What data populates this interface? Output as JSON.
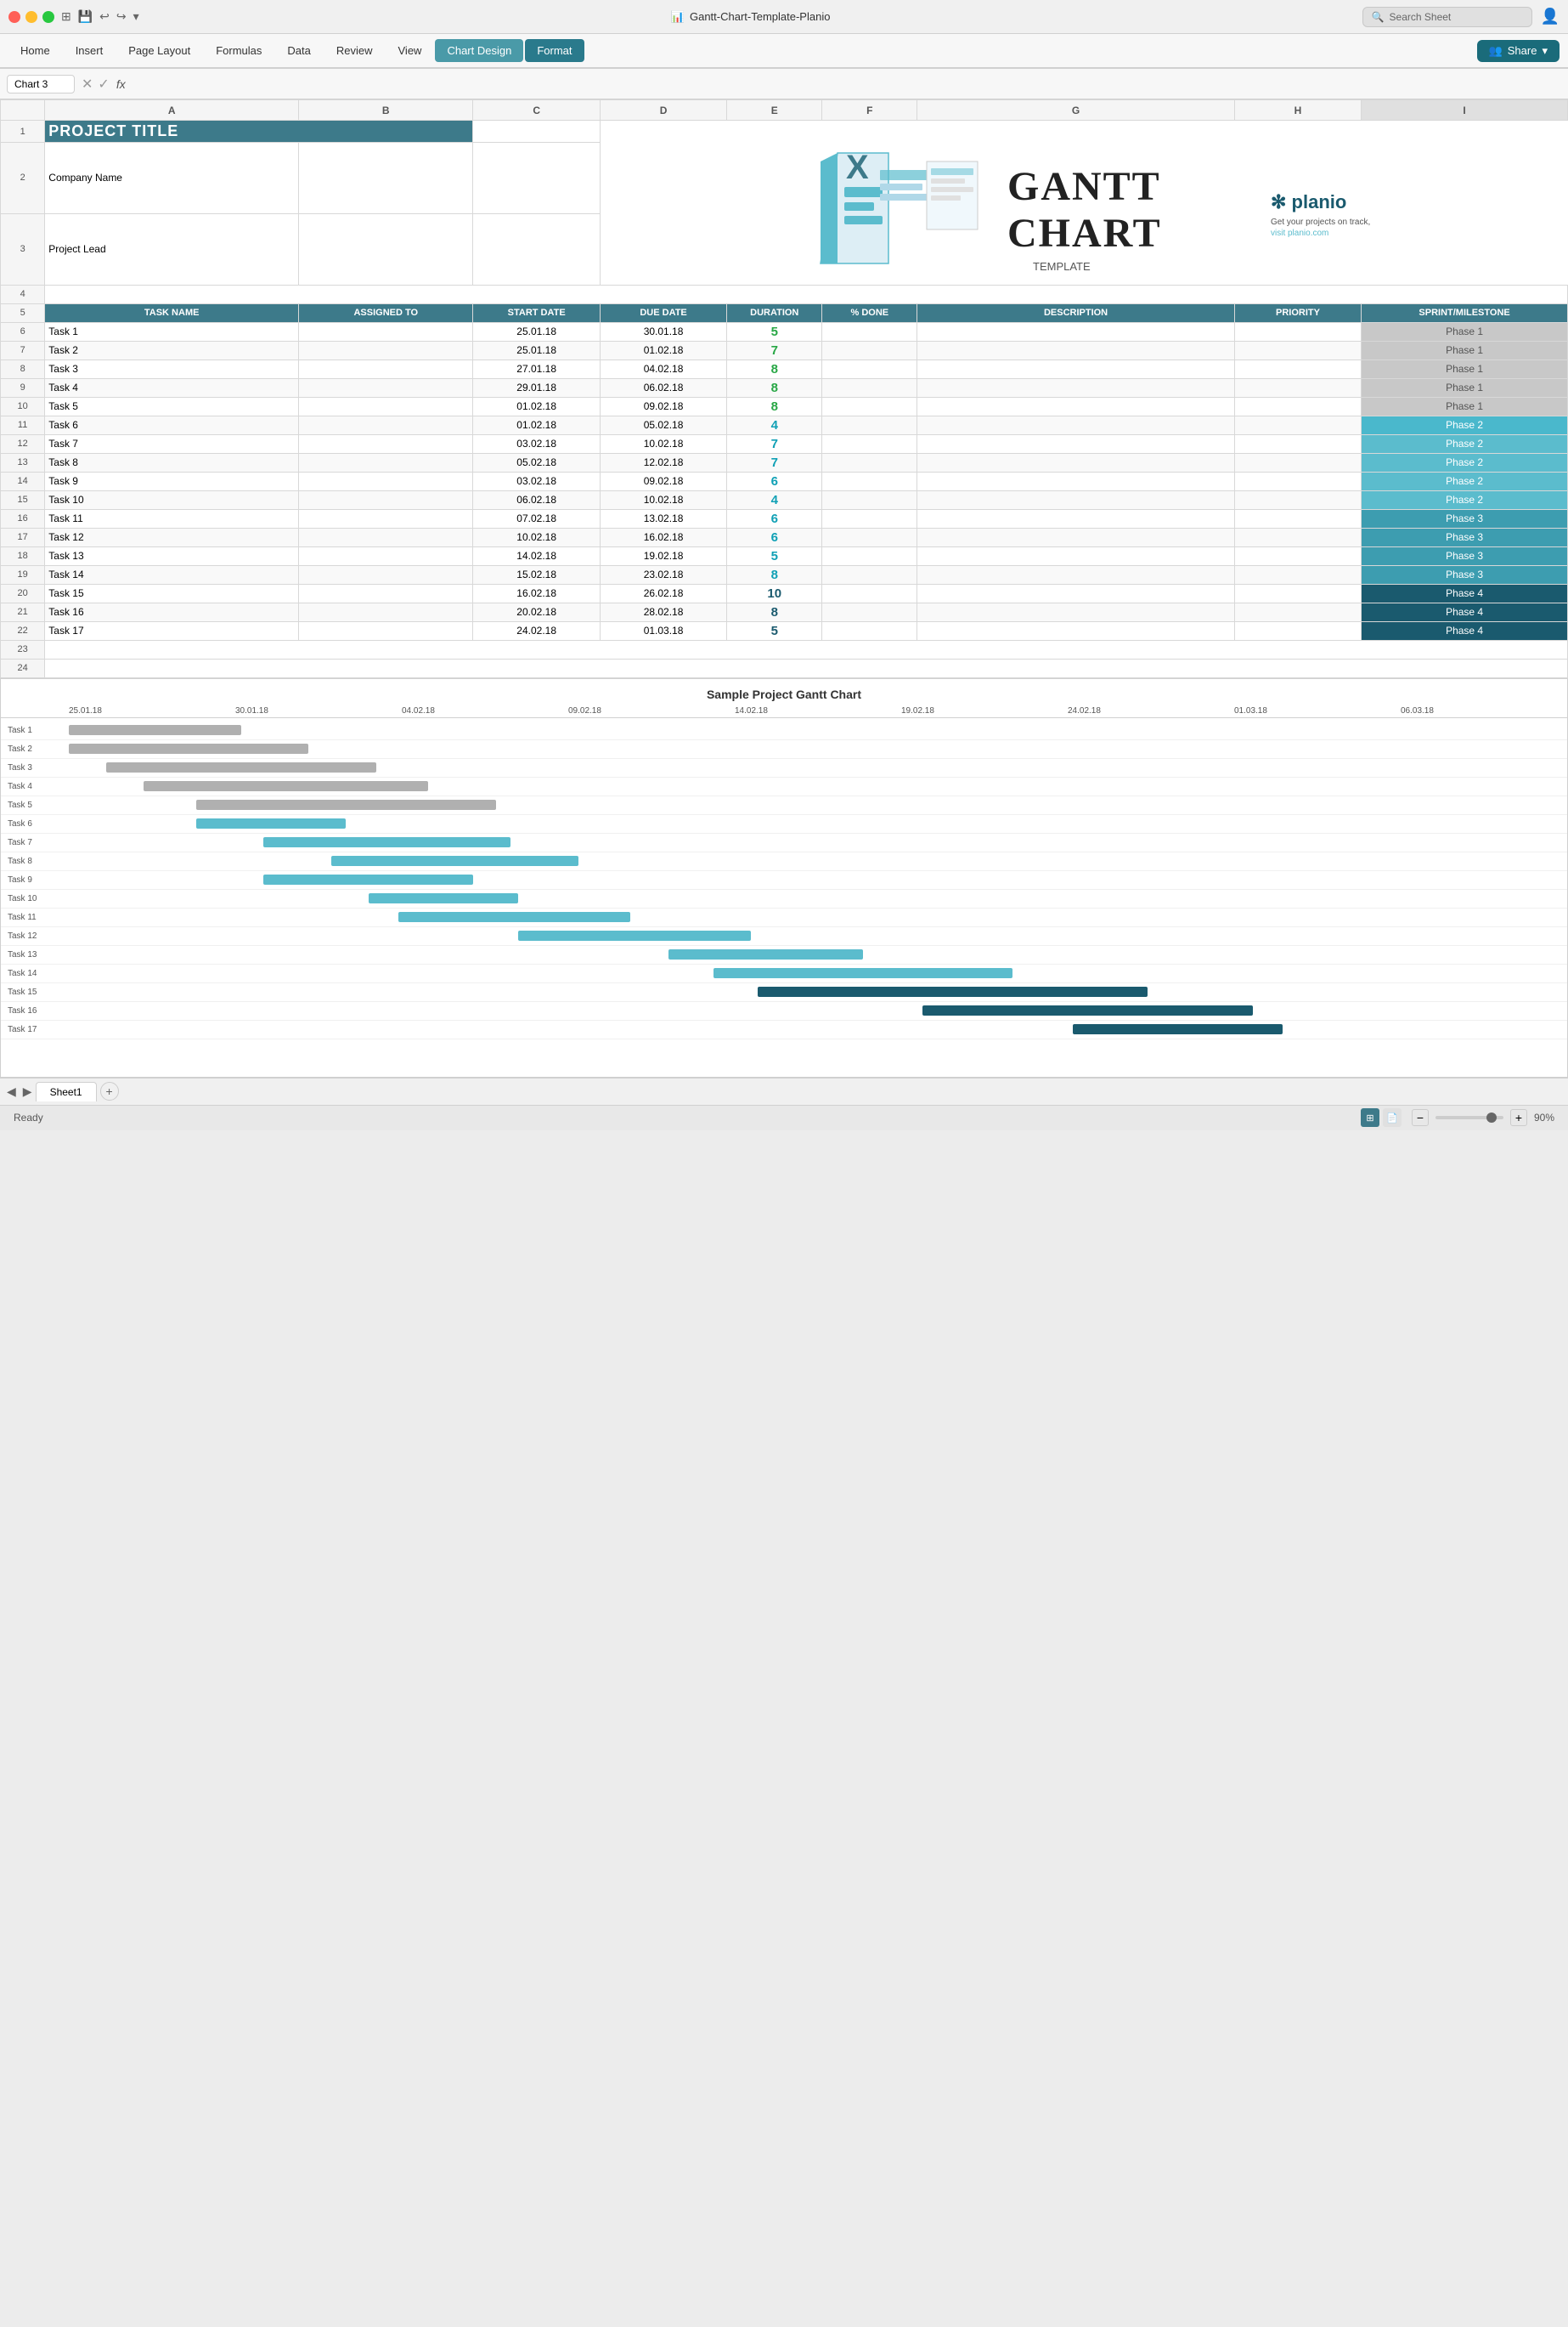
{
  "app": {
    "title": "Gantt-Chart-Template-Planio",
    "window_buttons": [
      "close",
      "minimize",
      "maximize"
    ]
  },
  "search": {
    "placeholder": "Search Sheet"
  },
  "tabs": {
    "items": [
      "Home",
      "Insert",
      "Page Layout",
      "Formulas",
      "Data",
      "Review",
      "View",
      "Chart Design",
      "Format"
    ],
    "active": "Chart Design"
  },
  "share_button": "Share",
  "formula_bar": {
    "cell_ref": "Chart 3",
    "fx": "fx"
  },
  "columns": {
    "headers": [
      "A",
      "B",
      "C",
      "D",
      "E",
      "F",
      "G",
      "H",
      "I"
    ],
    "widths": [
      160,
      110,
      80,
      80,
      80,
      60,
      200,
      80,
      130
    ]
  },
  "project": {
    "title": "PROJECT TITLE",
    "company": "Company Name",
    "lead": "Project Lead"
  },
  "table_headers": {
    "task_name": "TASK NAME",
    "assigned_to": "ASSIGNED TO",
    "start_date": "START DATE",
    "due_date": "DUE DATE",
    "duration": "DURATION",
    "pct_done": "% DONE",
    "description": "DESCRIPTION",
    "priority": "PRIORITY",
    "sprint": "SPRINT/MILESTONE"
  },
  "tasks": [
    {
      "id": 6,
      "name": "Task 1",
      "start": "25.01.18",
      "due": "30.01.18",
      "dur": "5",
      "dur_color": "green",
      "phase": "Phase 1",
      "phase_class": "phase-1"
    },
    {
      "id": 7,
      "name": "Task 2",
      "start": "25.01.18",
      "due": "01.02.18",
      "dur": "7",
      "dur_color": "green",
      "phase": "Phase 1",
      "phase_class": "phase-1"
    },
    {
      "id": 8,
      "name": "Task 3",
      "start": "27.01.18",
      "due": "04.02.18",
      "dur": "8",
      "dur_color": "green",
      "phase": "Phase 1",
      "phase_class": "phase-1"
    },
    {
      "id": 9,
      "name": "Task 4",
      "start": "29.01.18",
      "due": "06.02.18",
      "dur": "8",
      "dur_color": "green",
      "phase": "Phase 1",
      "phase_class": "phase-1"
    },
    {
      "id": 10,
      "name": "Task 5",
      "start": "01.02.18",
      "due": "09.02.18",
      "dur": "8",
      "dur_color": "green",
      "phase": "Phase 1",
      "phase_class": "phase-1"
    },
    {
      "id": 11,
      "name": "Task 6",
      "start": "01.02.18",
      "due": "05.02.18",
      "dur": "4",
      "dur_color": "teal",
      "phase": "Phase 2",
      "phase_class": "phase-selected"
    },
    {
      "id": 12,
      "name": "Task 7",
      "start": "03.02.18",
      "due": "10.02.18",
      "dur": "7",
      "dur_color": "teal",
      "phase": "Phase 2",
      "phase_class": "phase-2"
    },
    {
      "id": 13,
      "name": "Task 8",
      "start": "05.02.18",
      "due": "12.02.18",
      "dur": "7",
      "dur_color": "teal",
      "phase": "Phase 2",
      "phase_class": "phase-2"
    },
    {
      "id": 14,
      "name": "Task 9",
      "start": "03.02.18",
      "due": "09.02.18",
      "dur": "6",
      "dur_color": "teal",
      "phase": "Phase 2",
      "phase_class": "phase-2"
    },
    {
      "id": 15,
      "name": "Task 10",
      "start": "06.02.18",
      "due": "10.02.18",
      "dur": "4",
      "dur_color": "teal",
      "phase": "Phase 2",
      "phase_class": "phase-2"
    },
    {
      "id": 16,
      "name": "Task 11",
      "start": "07.02.18",
      "due": "13.02.18",
      "dur": "6",
      "dur_color": "teal",
      "phase": "Phase 3",
      "phase_class": "phase-3"
    },
    {
      "id": 17,
      "name": "Task 12",
      "start": "10.02.18",
      "due": "16.02.18",
      "dur": "6",
      "dur_color": "teal",
      "phase": "Phase 3",
      "phase_class": "phase-3"
    },
    {
      "id": 18,
      "name": "Task 13",
      "start": "14.02.18",
      "due": "19.02.18",
      "dur": "5",
      "dur_color": "teal",
      "phase": "Phase 3",
      "phase_class": "phase-3"
    },
    {
      "id": 19,
      "name": "Task 14",
      "start": "15.02.18",
      "due": "23.02.18",
      "dur": "8",
      "dur_color": "teal",
      "phase": "Phase 3",
      "phase_class": "phase-3"
    },
    {
      "id": 20,
      "name": "Task 15",
      "start": "16.02.18",
      "due": "26.02.18",
      "dur": "10",
      "dur_color": "dark",
      "phase": "Phase 4",
      "phase_class": "phase-4"
    },
    {
      "id": 21,
      "name": "Task 16",
      "start": "20.02.18",
      "due": "28.02.18",
      "dur": "8",
      "dur_color": "dark",
      "phase": "Phase 4",
      "phase_class": "phase-4"
    },
    {
      "id": 22,
      "name": "Task 17",
      "start": "24.02.18",
      "due": "01.03.18",
      "dur": "5",
      "dur_color": "dark",
      "phase": "Phase 4",
      "phase_class": "phase-4"
    }
  ],
  "gantt": {
    "title": "Sample Project Gantt Chart",
    "dates": [
      "25.01.18",
      "30.01.18",
      "04.02.18",
      "09.02.18",
      "14.02.18",
      "19.02.18",
      "24.02.18",
      "01.03.18",
      "06.03.18"
    ],
    "bars": [
      {
        "label": "Task 1",
        "start_pct": 0.0,
        "width_pct": 0.115,
        "color": "#b0b0b0"
      },
      {
        "label": "Task 2",
        "start_pct": 0.0,
        "width_pct": 0.16,
        "color": "#b0b0b0"
      },
      {
        "label": "Task 3",
        "start_pct": 0.025,
        "width_pct": 0.18,
        "color": "#b0b0b0"
      },
      {
        "label": "Task 4",
        "start_pct": 0.05,
        "width_pct": 0.19,
        "color": "#b0b0b0"
      },
      {
        "label": "Task 5",
        "start_pct": 0.085,
        "width_pct": 0.2,
        "color": "#b0b0b0"
      },
      {
        "label": "Task 6",
        "start_pct": 0.085,
        "width_pct": 0.1,
        "color": "#5bbccd"
      },
      {
        "label": "Task 7",
        "start_pct": 0.13,
        "width_pct": 0.165,
        "color": "#5bbccd"
      },
      {
        "label": "Task 8",
        "start_pct": 0.175,
        "width_pct": 0.165,
        "color": "#5bbccd"
      },
      {
        "label": "Task 9",
        "start_pct": 0.13,
        "width_pct": 0.14,
        "color": "#5bbccd"
      },
      {
        "label": "Task 10",
        "start_pct": 0.2,
        "width_pct": 0.1,
        "color": "#5bbccd"
      },
      {
        "label": "Task 11",
        "start_pct": 0.22,
        "width_pct": 0.155,
        "color": "#5bbccd"
      },
      {
        "label": "Task 12",
        "start_pct": 0.3,
        "width_pct": 0.155,
        "color": "#5bbccd"
      },
      {
        "label": "Task 13",
        "start_pct": 0.4,
        "width_pct": 0.13,
        "color": "#5bbccd"
      },
      {
        "label": "Task 14",
        "start_pct": 0.43,
        "width_pct": 0.2,
        "color": "#5bbccd"
      },
      {
        "label": "Task 15",
        "start_pct": 0.46,
        "width_pct": 0.26,
        "color": "#1a5a6e"
      },
      {
        "label": "Task 16",
        "start_pct": 0.57,
        "width_pct": 0.22,
        "color": "#1a5a6e"
      },
      {
        "label": "Task 17",
        "start_pct": 0.67,
        "width_pct": 0.14,
        "color": "#1a5a6e"
      }
    ]
  },
  "sheet_tab": "Sheet1",
  "status": {
    "ready": "Ready",
    "zoom": "90%"
  }
}
